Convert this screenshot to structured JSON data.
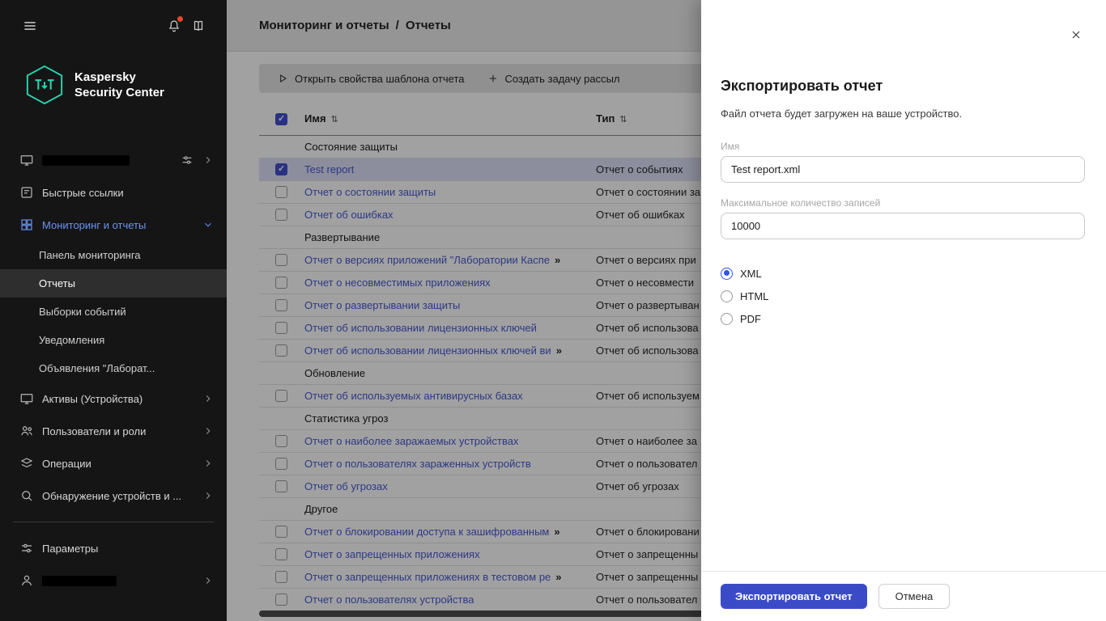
{
  "colors": {
    "accent_blue": "#3b4bc8",
    "sidebar_accent": "#6b93f2",
    "logo_teal": "#29d5ae",
    "link_blue": "#4456cc",
    "selected_row": "#dde1f7"
  },
  "sidebar": {
    "logo_line1": "Kaspersky",
    "logo_line2": "Security Center",
    "quick_links": "Быстрые ссылки",
    "monitoring": "Мониторинг и отчеты",
    "submenu": [
      "Панель мониторинга",
      "Отчеты",
      "Выборки событий",
      "Уведомления",
      "Объявления \"Лаборат..."
    ],
    "assets": "Активы (Устройства)",
    "users_roles": "Пользователи и роли",
    "operations": "Операции",
    "discovery": "Обнаружение устройств и ...",
    "settings": "Параметры"
  },
  "header": {
    "breadcrumb_section": "Мониторинг и отчеты",
    "breadcrumb_separator": "/",
    "breadcrumb_page": "Отчеты"
  },
  "toolbar": {
    "open_template": "Открыть свойства шаблона отчета",
    "create_task": "Создать задачу рассыл"
  },
  "table": {
    "col_name": "Имя",
    "col_type": "Тип",
    "select_all_checked": true,
    "groups": [
      {
        "title": "Состояние защиты",
        "rows": [
          {
            "name": "Test report",
            "type": "Отчет о событиях",
            "checked": true,
            "selected": true
          },
          {
            "name": "Отчет о состоянии защиты",
            "type": "Отчет о состоянии за"
          },
          {
            "name": "Отчет об ошибках",
            "type": "Отчет об ошибках"
          }
        ]
      },
      {
        "title": "Развертывание",
        "rows": [
          {
            "name": "Отчет о версиях приложений \"Лаборатории Каспе",
            "type": "Отчет о версиях при",
            "trunc": true
          },
          {
            "name": "Отчет о несовместимых приложениях",
            "type": "Отчет о несовмести"
          },
          {
            "name": "Отчет о развертывании защиты",
            "type": "Отчет о развертыван"
          },
          {
            "name": "Отчет об использовании лицензионных ключей",
            "type": "Отчет об использова"
          },
          {
            "name": "Отчет об использовании лицензионных ключей ви",
            "type": "Отчет об использова",
            "trunc": true
          }
        ]
      },
      {
        "title": "Обновление",
        "rows": [
          {
            "name": "Отчет об используемых антивирусных базах",
            "type": "Отчет об используем"
          }
        ]
      },
      {
        "title": "Статистика угроз",
        "rows": [
          {
            "name": "Отчет о наиболее заражаемых устройствах",
            "type": "Отчет о наиболее за"
          },
          {
            "name": "Отчет о пользователях зараженных устройств",
            "type": "Отчет о пользовател"
          },
          {
            "name": "Отчет об угрозах",
            "type": "Отчет об угрозах"
          }
        ]
      },
      {
        "title": "Другое",
        "rows": [
          {
            "name": "Отчет о блокировании доступа к зашифрованным",
            "type": "Отчет о блокировани",
            "trunc": true
          },
          {
            "name": "Отчет о запрещенных приложениях",
            "type": "Отчет о запрещенны"
          },
          {
            "name": "Отчет о запрещенных приложениях в тестовом ре",
            "type": "Отчет о запрещенны",
            "trunc": true
          },
          {
            "name": "Отчет о пользователях устройства",
            "type": "Отчет о пользовател"
          }
        ]
      }
    ]
  },
  "drawer": {
    "title": "Экспортировать отчет",
    "subtitle": "Файл отчета будет загружен на ваше устройство.",
    "name_label": "Имя",
    "name_value": "Test report.xml",
    "max_label": "Максимальное количество записей",
    "max_value": "10000",
    "formats": [
      {
        "label": "XML",
        "selected": true
      },
      {
        "label": "HTML",
        "selected": false
      },
      {
        "label": "PDF",
        "selected": false
      }
    ],
    "export_label": "Экспортировать отчет",
    "cancel_label": "Отмена"
  }
}
